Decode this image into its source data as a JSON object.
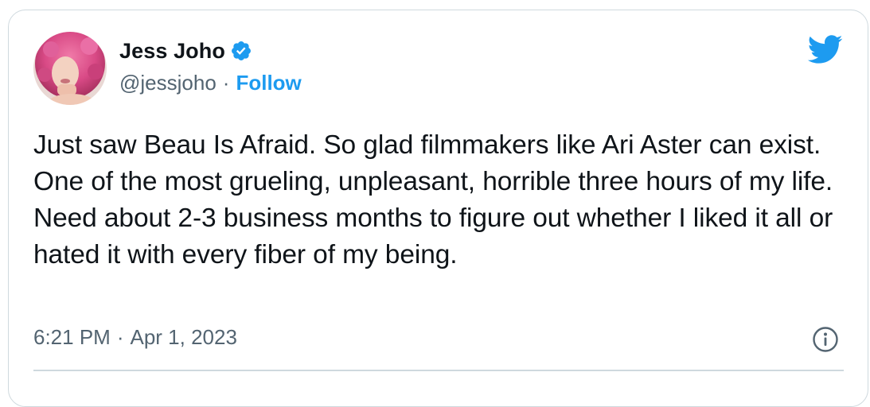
{
  "tweet": {
    "author_name": "Jess Joho",
    "author_handle": "@jessjoho",
    "separator": "·",
    "follow_label": "Follow",
    "verified": true,
    "text": "Just saw Beau Is Afraid. So glad filmmakers like Ari Aster can exist. One of the most grueling, unpleasant, horrible three hours of my life. Need about 2-3 business months to figure out whether I liked it all or hated it with every fiber of my being.",
    "time": "6:21 PM",
    "date": "Apr 1, 2023"
  },
  "icons": {
    "brand": "twitter-bird-icon",
    "verified": "verified-badge-icon",
    "info": "info-icon"
  },
  "colors": {
    "accent": "#1d9bf0",
    "text": "#0f1419",
    "secondary_text": "#536471",
    "border": "#cfd9de"
  }
}
